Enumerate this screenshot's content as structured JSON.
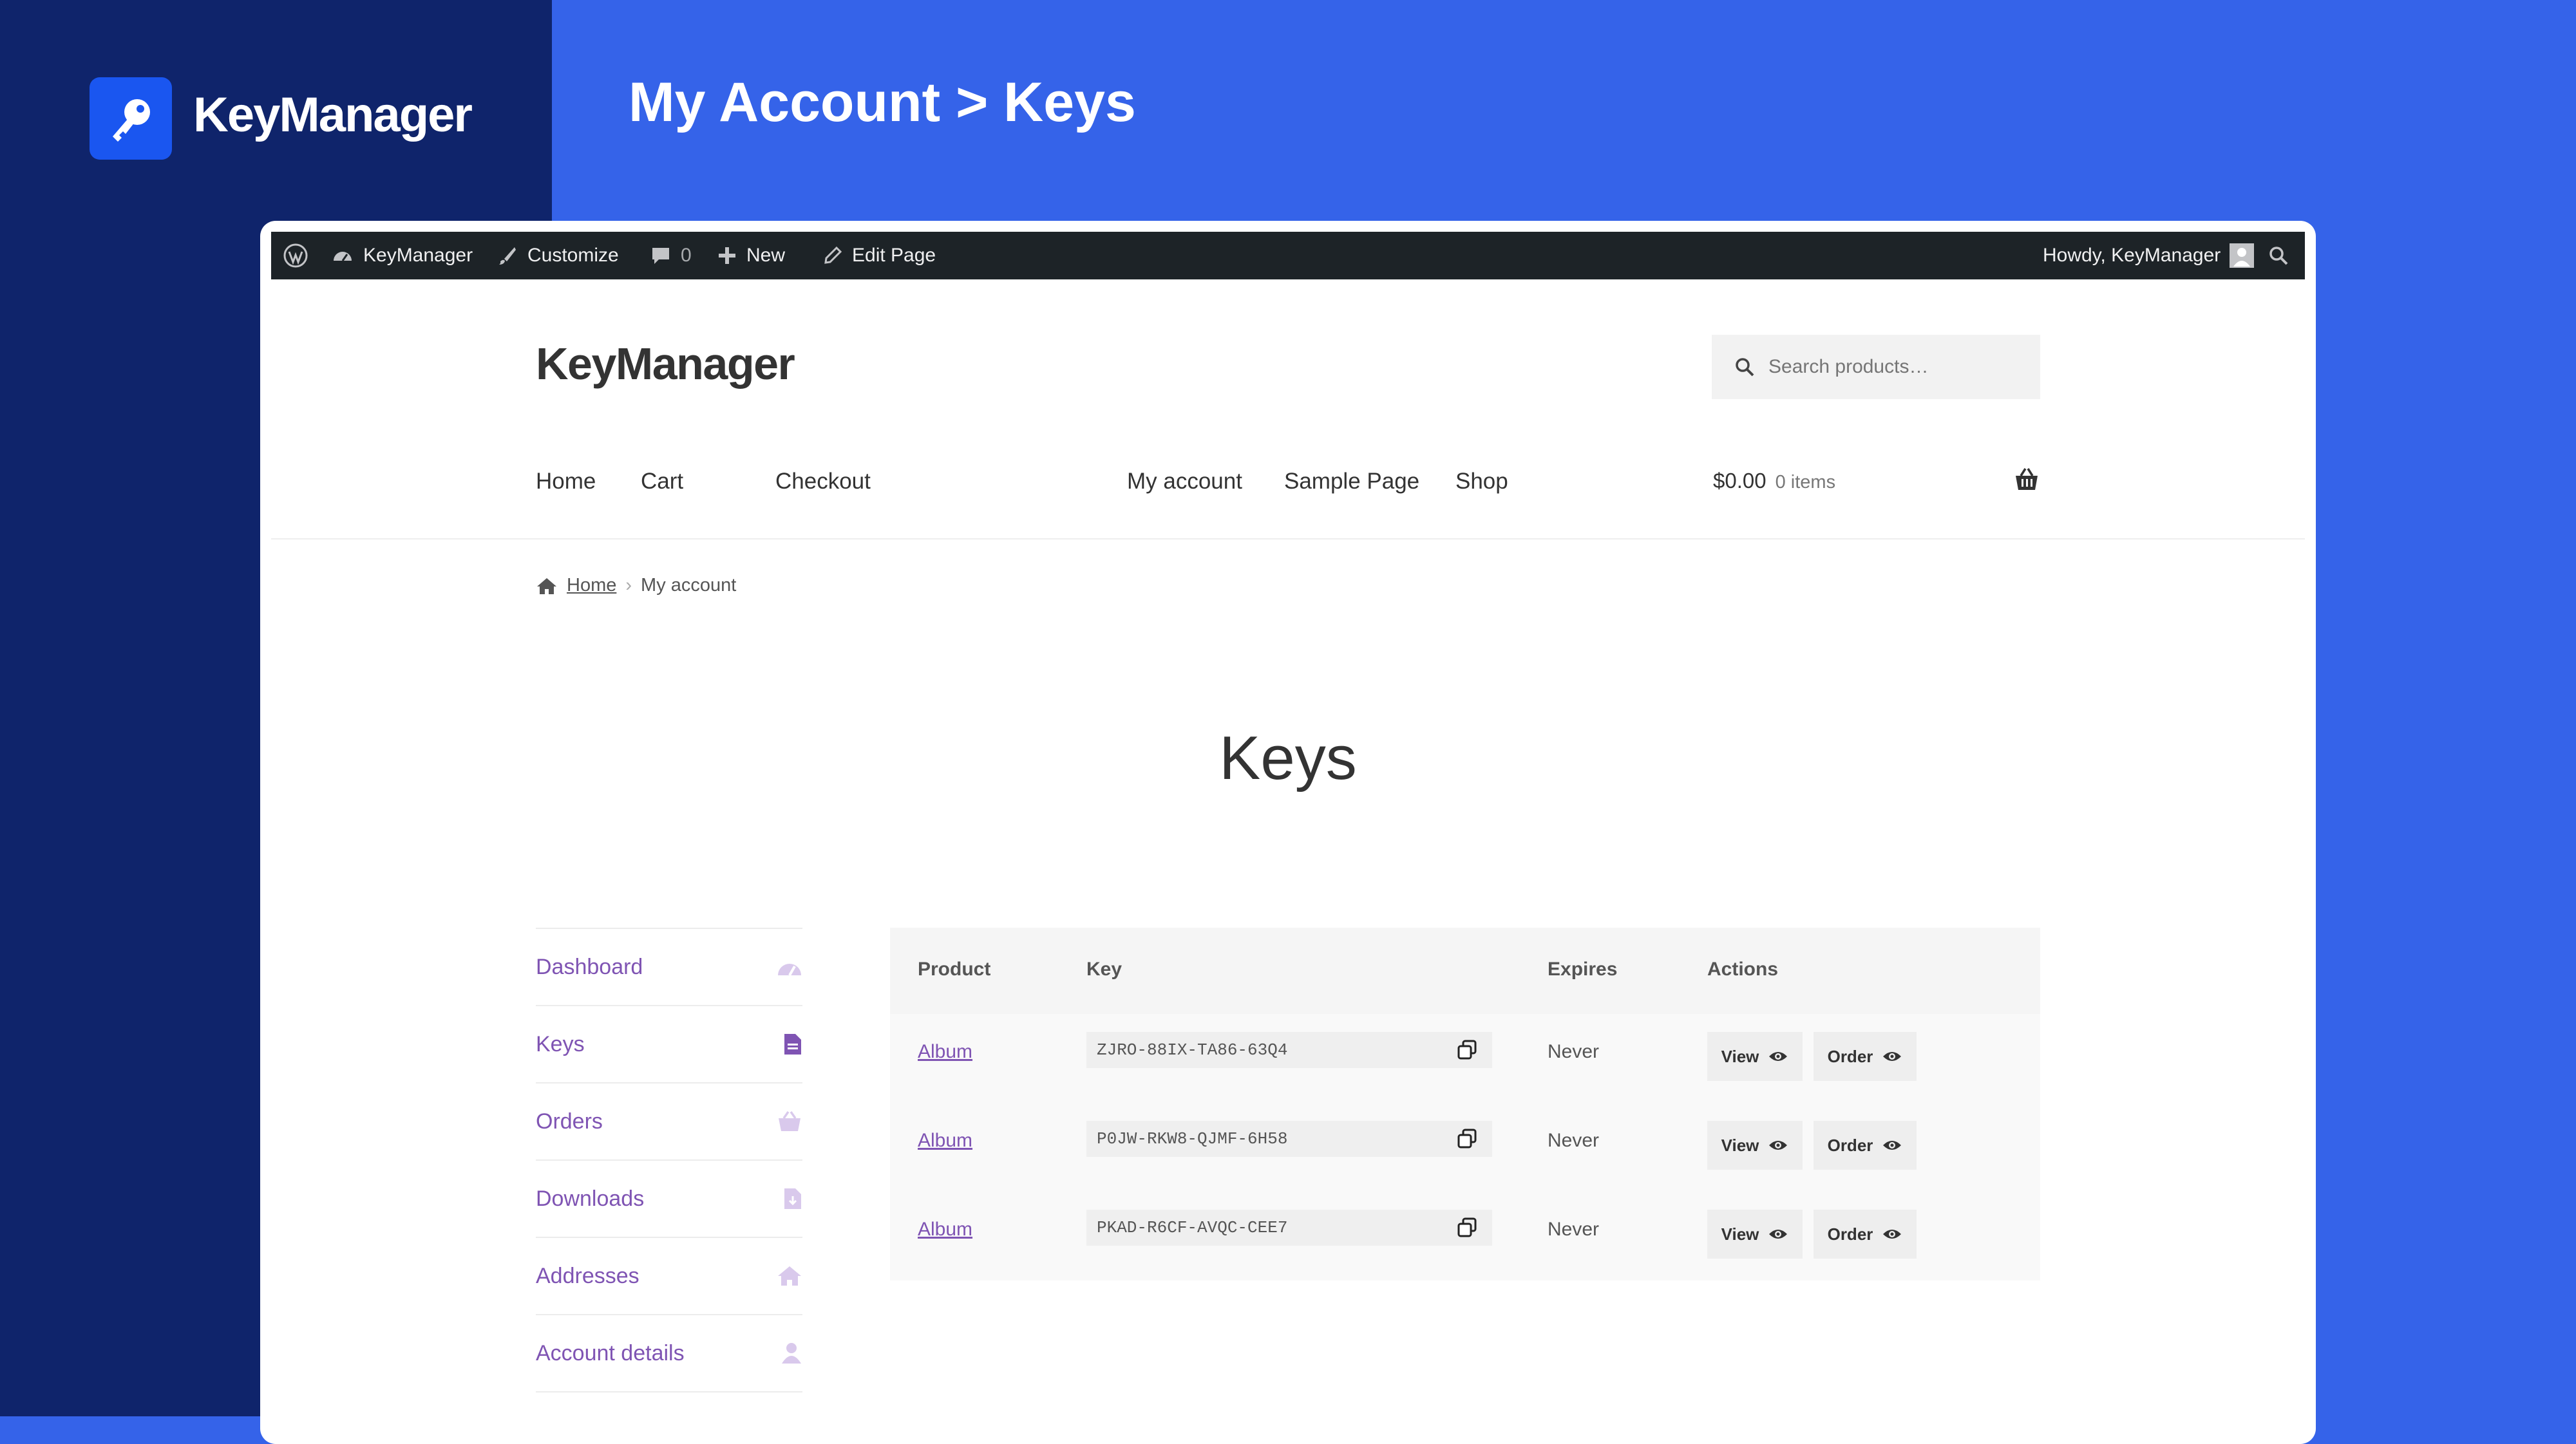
{
  "brand": {
    "name": "KeyManager"
  },
  "page_heading": "My Account > Keys",
  "admin_bar": {
    "site_name": "KeyManager",
    "customize": "Customize",
    "comments_count": "0",
    "new": "New",
    "edit_page": "Edit Page",
    "howdy": "Howdy, KeyManager"
  },
  "site": {
    "title": "KeyManager",
    "search_placeholder": "Search products…",
    "nav": [
      "Home",
      "Cart",
      "Checkout",
      "My account",
      "Sample Page",
      "Shop"
    ],
    "cart_total": "$0.00",
    "cart_count": "0 items"
  },
  "breadcrumb": {
    "home": "Home",
    "current": "My account"
  },
  "page_title": "Keys",
  "account_nav": [
    {
      "label": "Dashboard",
      "icon": "dashboard-icon"
    },
    {
      "label": "Keys",
      "icon": "file-icon"
    },
    {
      "label": "Orders",
      "icon": "basket-icon"
    },
    {
      "label": "Downloads",
      "icon": "download-file-icon"
    },
    {
      "label": "Addresses",
      "icon": "home-icon"
    },
    {
      "label": "Account details",
      "icon": "user-icon"
    }
  ],
  "keys_table": {
    "columns": [
      "Product",
      "Key",
      "Expires",
      "Actions"
    ],
    "rows": [
      {
        "product": "Album",
        "key": "ZJRO-88IX-TA86-63Q4",
        "expires": "Never",
        "view": "View",
        "order": "Order"
      },
      {
        "product": "Album",
        "key": "P0JW-RKW8-QJMF-6H58",
        "expires": "Never",
        "view": "View",
        "order": "Order"
      },
      {
        "product": "Album",
        "key": "PKAD-R6CF-AVQC-CEE7",
        "expires": "Never",
        "view": "View",
        "order": "Order"
      }
    ]
  },
  "colors": {
    "background": "#3563e9",
    "brand_panel": "#0f246b",
    "admin_bar": "#1d2327",
    "link_purple": "#7f54b3"
  }
}
